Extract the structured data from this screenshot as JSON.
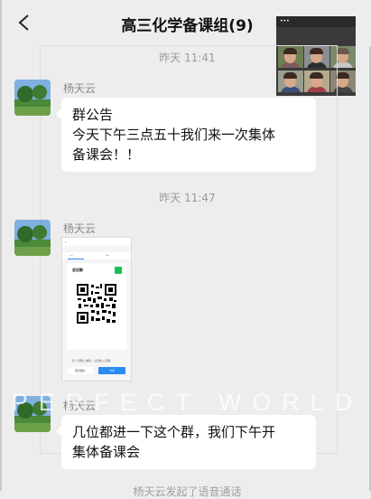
{
  "header": {
    "title": "高三化学备课组(9)",
    "back_icon": "chevron-left-icon"
  },
  "video_call": {
    "status_text": "..."
  },
  "messages": [
    {
      "time": "昨天 11:41",
      "sender": "杨天云",
      "type": "text",
      "lines": [
        "群公告",
        "今天下午三点五十我们来一次集体",
        "备课会！！"
      ]
    },
    {
      "time": "昨天 11:47",
      "sender": "杨天云",
      "type": "image",
      "image": {
        "group_label": "会议群",
        "note": "扫一扫群二维码，立刻加入该群。",
        "btn_left": "保存图片",
        "btn_right": "分享"
      }
    },
    {
      "sender": "杨天云",
      "type": "text",
      "lines": [
        "几位都进一下这个群，我们下午开",
        "集体备课会"
      ]
    }
  ],
  "watermark": "PERFECT WORLD",
  "bottom_hint": "杨天云发起了语音通话",
  "colors": {
    "background": "#ededed",
    "bubble": "#ffffff",
    "accent": "#2a8cf0",
    "green": "#1bbf55"
  }
}
